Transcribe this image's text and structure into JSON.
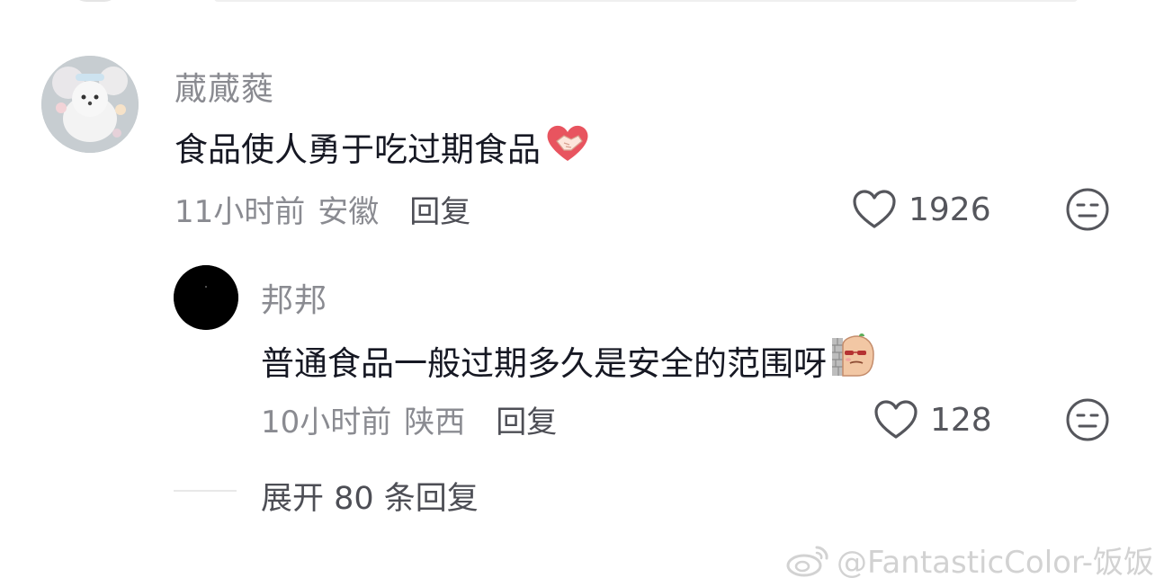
{
  "comments": [
    {
      "username": "蕆蕆蕤",
      "text": "食品使人勇于吃过期食品",
      "emoji_icon": "handshake-heart-icon",
      "time": "11小时前",
      "location": "安徽",
      "reply_label": "回复",
      "likes": "1926"
    },
    {
      "username": "邦邦",
      "text": "普通食品一般过期多久是安全的范围呀",
      "emoji_icon": "peeking-potato-icon",
      "time": "10小时前",
      "location": "陕西",
      "reply_label": "回复",
      "likes": "128"
    }
  ],
  "expand_label": "展开 80 条回复",
  "watermark": "@FantasticColor-饭饭",
  "colors": {
    "text_primary": "#161823",
    "text_secondary": "#8a8b91",
    "icon": "#55565c"
  }
}
